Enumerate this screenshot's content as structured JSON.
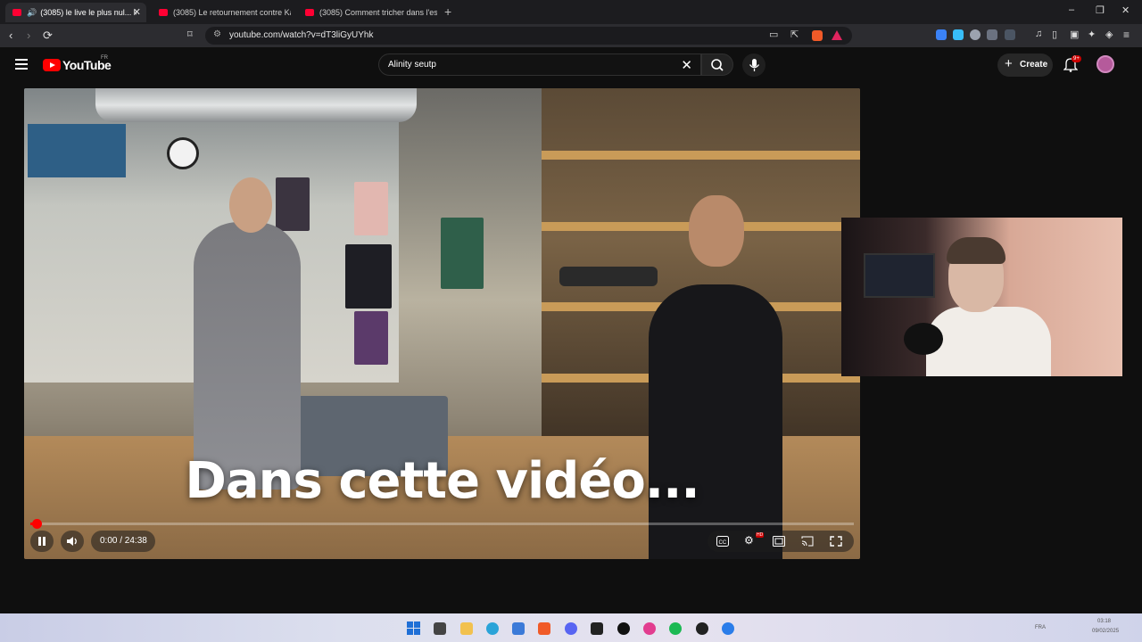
{
  "browser": {
    "tabs": [
      {
        "title": "(3085) le live le plus nul... les",
        "active": true
      },
      {
        "title": "(3085) Le retournement contre Kai C",
        "active": false
      },
      {
        "title": "(3085) Comment tricher dans l'espor",
        "active": false
      }
    ],
    "new_tab": "+",
    "url": "youtube.com/watch?v=dT3liGyUYhk",
    "window_controls": {
      "minimize": "–",
      "restore": "❐",
      "close": "✕"
    }
  },
  "youtube": {
    "logo_text": "YouTube",
    "country_code": "FR",
    "search_value": "Alinity seutp",
    "create_label": "Create",
    "notification_badge": "9+"
  },
  "player": {
    "subtitle_text": "Dans cette vidéo...",
    "time_display": "0:00 / 24:38",
    "progress_fraction": 0.008,
    "hd_badge": "HD"
  },
  "colors": {
    "accent_red": "#ff0000",
    "tab_favicon": "#ff0033",
    "loading_bar": "#e0245e"
  },
  "taskbar": {
    "lang": "FRA",
    "time": "03:18",
    "date": "09/02/2025"
  }
}
